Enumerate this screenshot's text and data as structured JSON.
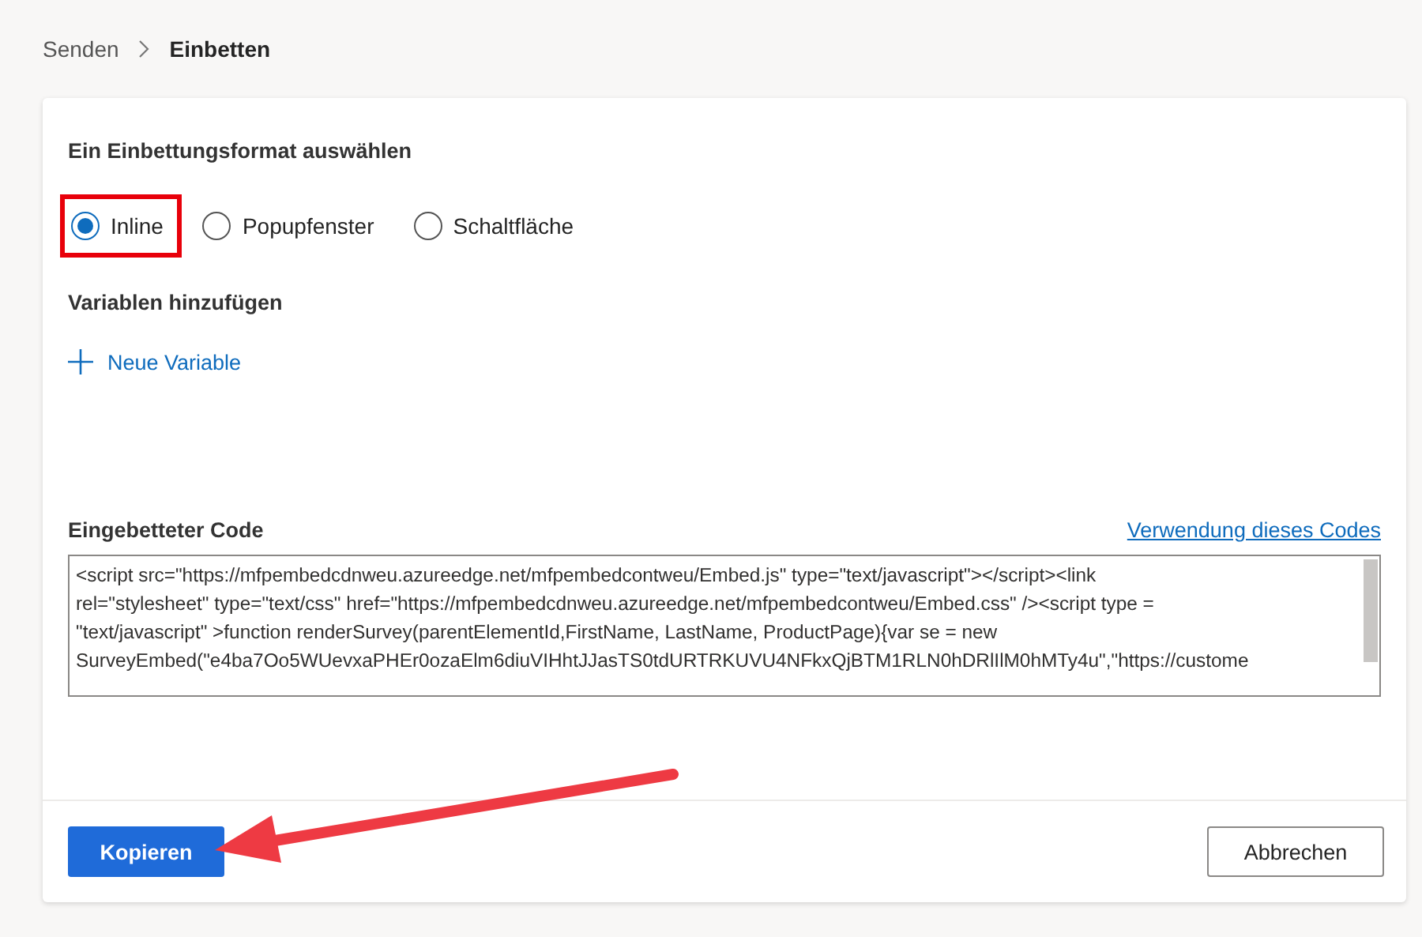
{
  "breadcrumb": [
    {
      "label": "Senden",
      "current": false
    },
    {
      "label": "Einbetten",
      "current": true
    }
  ],
  "format_section": {
    "title": "Ein Einbettungsformat auswählen",
    "options": [
      {
        "label": "Inline",
        "selected": true,
        "highlighted": true
      },
      {
        "label": "Popupfenster",
        "selected": false,
        "highlighted": false
      },
      {
        "label": "Schaltfläche",
        "selected": false,
        "highlighted": false
      }
    ]
  },
  "variables_section": {
    "title": "Variablen hinzufügen",
    "add_link": "Neue Variable"
  },
  "code_section": {
    "title": "Eingebetteter Code",
    "help_link": "Verwendung dieses Codes",
    "code_lines": [
      "<script src=\"https://mfpembedcdnweu.azureedge.net/mfpembedcontweu/Embed.js\" type=\"text/javascript\"></script><link",
      "rel=\"stylesheet\" type=\"text/css\" href=\"https://mfpembedcdnweu.azureedge.net/mfpembedcontweu/Embed.css\" /><script type =",
      "\"text/javascript\" >function renderSurvey(parentElementId,FirstName, LastName, ProductPage){var se = new",
      "SurveyEmbed(\"e4ba7Oo5WUevxaPHEr0ozaElm6diuVIHhtJJasTS0tdURTRKUVU4NFkxQjBTM1RLN0hDRlIlM0hMTy4u\",\"https://custome"
    ]
  },
  "footer": {
    "primary_button": "Kopieren",
    "secondary_button": "Abbrechen"
  },
  "annotation_arrow": {
    "shown": true
  }
}
